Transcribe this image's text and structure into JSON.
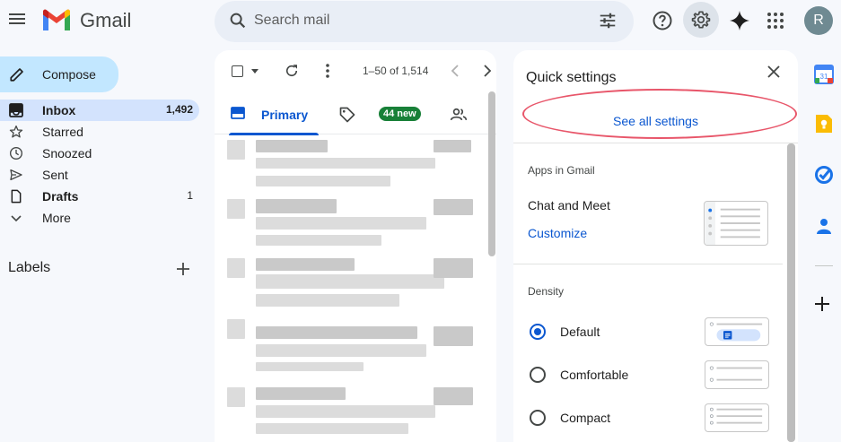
{
  "header": {
    "app_name": "Gmail",
    "search_placeholder": "Search mail",
    "avatar_initial": "R",
    "accent_color": "#0b57d0"
  },
  "sidebar": {
    "compose_label": "Compose",
    "items": [
      {
        "label": "Inbox",
        "count": "1,492",
        "icon": "inbox-icon",
        "active": true
      },
      {
        "label": "Starred",
        "count": "",
        "icon": "star-icon"
      },
      {
        "label": "Snoozed",
        "count": "",
        "icon": "clock-icon"
      },
      {
        "label": "Sent",
        "count": "",
        "icon": "send-icon"
      },
      {
        "label": "Drafts",
        "count": "1",
        "icon": "draft-icon"
      },
      {
        "label": "More",
        "count": "",
        "icon": "chevron-down-icon"
      }
    ],
    "labels_heading": "Labels"
  },
  "mail_list": {
    "range": "1–50 of 1,514",
    "tabs": [
      {
        "label": "Primary",
        "active": true
      },
      {
        "label": "44 new",
        "type": "badge"
      }
    ]
  },
  "quick_settings": {
    "title": "Quick settings",
    "see_all": "See all settings",
    "apps_heading": "Apps in Gmail",
    "chat_meet": "Chat and Meet",
    "customize": "Customize",
    "density_heading": "Density",
    "density_options": [
      {
        "label": "Default",
        "selected": true
      },
      {
        "label": "Comfortable",
        "selected": false
      },
      {
        "label": "Compact",
        "selected": false
      }
    ]
  }
}
